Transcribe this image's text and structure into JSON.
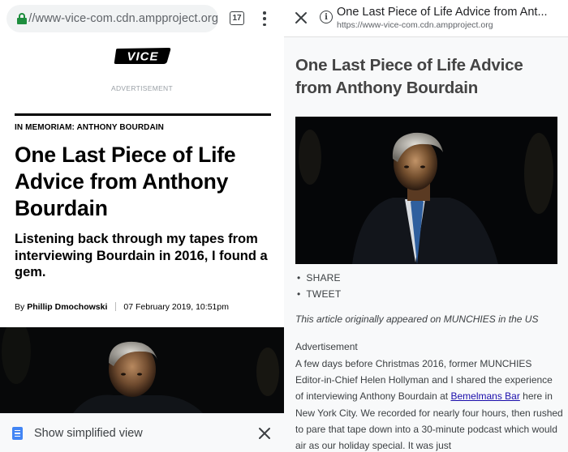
{
  "left": {
    "address_bar": {
      "url": "//www-vice-com.cdn.ampproject.org",
      "tab_count": "17",
      "lock_icon": "lock-icon",
      "menu_icon": "more-vert-icon"
    },
    "logo_text": "VICE",
    "ad_label": "ADVERTISEMENT",
    "kicker": "IN MEMORIAM: ANTHONY BOURDAIN",
    "headline": "One Last Piece of Life Advice from Anthony Bourdain",
    "dek": "Listening back through my tapes from interviewing Bourdain in 2016, I found a gem.",
    "byline": {
      "prefix": "By",
      "author": "Phillip Dmochowski",
      "date": "07 February 2019, 10:51pm"
    },
    "simplified_bar": {
      "label": "Show simplified view",
      "icon": "document-icon",
      "close_icon": "close-icon"
    }
  },
  "right": {
    "header": {
      "title": "One Last Piece of Life Advice from Ant...",
      "url": "https://www-vice-com.cdn.ampproject.org",
      "close_icon": "close-icon",
      "info_icon": "info-icon"
    },
    "headline": "One Last Piece of Life Advice from Anthony Bourdain",
    "share_items": [
      "SHARE",
      "TWEET"
    ],
    "original_note": "This article originally appeared on MUNCHIES in the US",
    "advertisement": "Advertisement",
    "paragraph": {
      "before_link": "A few days before Christmas 2016, former MUNCHIES Editor-in-Chief Helen Hollyman and I shared the experience of interviewing Anthony Bourdain at ",
      "link_text": "Bemelmans Bar",
      "after_link": " here in New York City. We recorded for nearly four hours, then rushed to pare that tape down into a 30-minute podcast which would air as our holiday special. It was just"
    }
  },
  "colors": {
    "lock_green": "#1e8e3e",
    "link_blue": "#1a0dab",
    "doc_icon_blue": "#4285f4",
    "reader_background": "#f8f9fa"
  }
}
